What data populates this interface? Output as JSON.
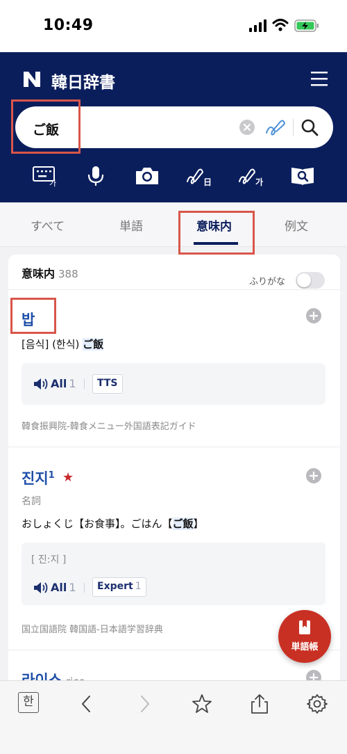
{
  "status_bar": {
    "time": "10:49"
  },
  "header": {
    "title": "韓日辞書"
  },
  "search": {
    "value": "ご飯"
  },
  "tools": [
    {
      "icon": "keyboard-hangul-icon"
    },
    {
      "icon": "microphone-icon"
    },
    {
      "icon": "camera-icon"
    },
    {
      "icon": "handwriting-japanese-icon",
      "label": "日"
    },
    {
      "icon": "handwriting-korean-icon",
      "label": "가"
    },
    {
      "icon": "book-search-icon"
    }
  ],
  "keyboard_badge": "가",
  "tabs": [
    {
      "label": "すべて",
      "active": false
    },
    {
      "label": "単語",
      "active": false
    },
    {
      "label": "意味内",
      "active": true
    },
    {
      "label": "例文",
      "active": false
    }
  ],
  "results": {
    "section_label": "意味内",
    "count": "388",
    "furigana_label": "ふりがな",
    "furigana_on": false
  },
  "entries": [
    {
      "word": "밥",
      "meaning_prefix": "[음식] (한식) ",
      "meaning_highlight": "ご飯",
      "audio_label": "All",
      "audio_count": "1",
      "chip_label": "TTS",
      "source": "韓食振興院-韓食メニュー外国語表記ガイド"
    },
    {
      "word": "진지",
      "superscript": "1",
      "star": "★",
      "pos": "名詞",
      "meaning_prefix": "おしょくじ【お食事】。ごはん【",
      "meaning_highlight": "ご飯",
      "meaning_suffix": "】",
      "pronunciation": "[ 진:지 ]",
      "audio_label": "All",
      "audio_count": "1",
      "chip_label": "Expert",
      "chip_count": "1",
      "source": "国立国語院 韓国語-日本語学習辞典"
    },
    {
      "word": "라이스",
      "sub": "rice"
    }
  ],
  "fab": {
    "label": "単語帳"
  },
  "toolbar": {
    "korean_key": "한"
  },
  "colors": {
    "header": "#0b1e5c",
    "accent_blue": "#1e4fa8",
    "annotation_red": "#d8564a",
    "fab_red": "#c93024"
  }
}
